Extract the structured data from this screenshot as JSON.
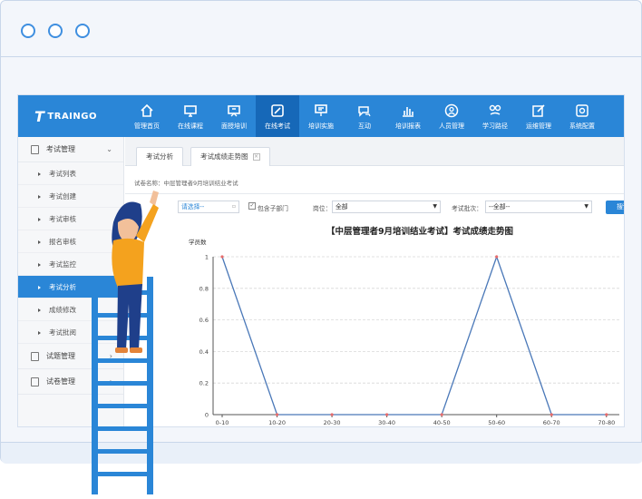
{
  "app": {
    "logo_text": "TRAINGO",
    "logo_mark": "T"
  },
  "nav": [
    {
      "label": "管理首页",
      "icon": "home-icon"
    },
    {
      "label": "在线课程",
      "icon": "monitor-icon"
    },
    {
      "label": "面授培训",
      "icon": "presentation-icon"
    },
    {
      "label": "在线考试",
      "icon": "edit-icon",
      "active": true
    },
    {
      "label": "培训实施",
      "icon": "projector-icon"
    },
    {
      "label": "互动",
      "icon": "chat-icon"
    },
    {
      "label": "培训报表",
      "icon": "bar-chart-icon"
    },
    {
      "label": "人员管理",
      "icon": "user-icon"
    },
    {
      "label": "学习路径",
      "icon": "path-icon"
    },
    {
      "label": "运维管理",
      "icon": "pen-square-icon"
    },
    {
      "label": "系统配置",
      "icon": "settings-icon"
    }
  ],
  "sidebar": {
    "groups": [
      {
        "label": "考试管理",
        "chevron": "⌄"
      },
      {
        "label": "试题管理",
        "chevron": "›"
      },
      {
        "label": "试卷管理",
        "chevron": "›"
      }
    ],
    "items": [
      "考试列表",
      "考试创建",
      "考试审核",
      "报名审核",
      "考试监控",
      "考试分析",
      "成绩修改",
      "考试批阅"
    ],
    "active_item": "考试分析"
  },
  "tabs": [
    {
      "label": "考试分析",
      "closable": false
    },
    {
      "label": "考试成绩走势图",
      "closable": true,
      "close_glyph": "×"
    }
  ],
  "main": {
    "paper_name": "试卷名称：中层管理者9月培训结业考试",
    "filters": {
      "department_prefix": "门：",
      "department_placeholder": "请选择--",
      "include_sub_label": "包含子部门",
      "include_sub_checked": true,
      "position_label": "岗位：",
      "position_value": "全部",
      "batch_label": "考试批次：",
      "batch_value": "--全部--",
      "search_label": "搜索"
    }
  },
  "chart_data": {
    "type": "line",
    "title": "【中层管理者9月培训结业考试】考试成绩走势图",
    "ylabel": "学员数",
    "xlabel": "",
    "categories": [
      "0-10",
      "10-20",
      "20-30",
      "30-40",
      "40-50",
      "50-60",
      "60-70",
      "70-80"
    ],
    "series": [
      {
        "name": "",
        "values": [
          1,
          0,
          0,
          0,
          0,
          1,
          0,
          0
        ]
      }
    ],
    "ylim": [
      0,
      1
    ],
    "yticks": [
      "0",
      "0.2",
      "0.4",
      "0.6",
      "0.8",
      "1"
    ],
    "grid": "horizontal-dashed",
    "line_color": "#4a78b8",
    "marker_color": "#e76b6b"
  },
  "colors": {
    "accent": "#2a86d7",
    "accent_dark": "#1668b8"
  }
}
